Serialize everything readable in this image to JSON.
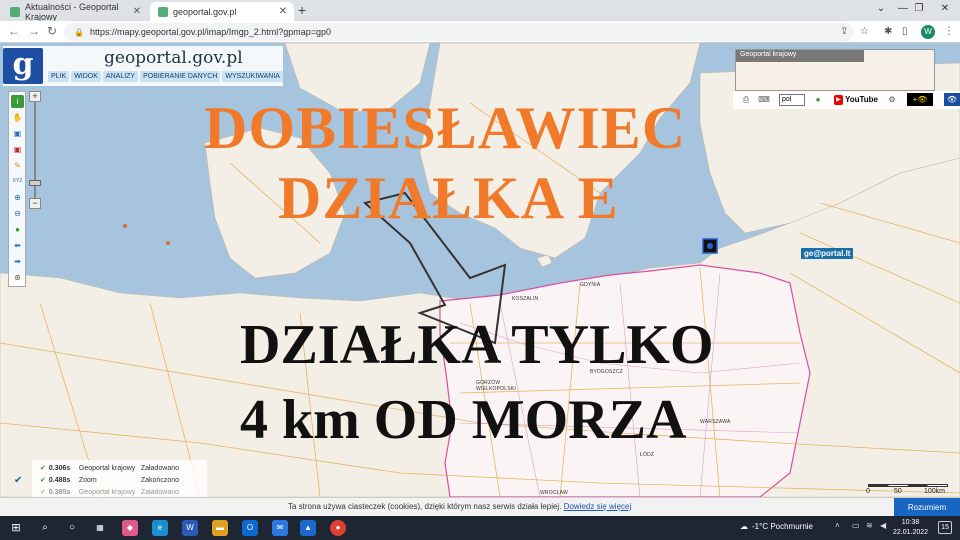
{
  "browser": {
    "tabs": [
      {
        "label": "Aktualności - Geoportal Krajowy"
      },
      {
        "label": "geoportal.gov.pl"
      }
    ],
    "url": "https://mapy.geoportal.gov.pl/imap/Imgp_2.html?gpmap=gp0",
    "profile_initial": "W"
  },
  "geoportal": {
    "logo_letter": "g",
    "title": "geoportal.gov.pl",
    "menu": [
      "PLIK",
      "WIDOK",
      "ANALIZY",
      "POBIERANIE DANYCH",
      "WYSZUKIWANIA"
    ],
    "minimap_label": "Geoportal krajowy",
    "lang": "pol",
    "youtube": "YouTube",
    "gelt": "ge@portal.lt"
  },
  "overlay": {
    "line1": "DOBIESŁAWIEC",
    "line2": "DZIAŁKA E",
    "line3": "DZIAŁKA TYLKO",
    "line4": "4 km OD MORZA"
  },
  "cities": {
    "koszalin": "KOSZALIN",
    "gdynia": "GDYNIA",
    "gorzow": "GORZÓW WIELKOPOLSKI",
    "bydgoszcz": "BYDGOSZCZ",
    "warszawa": "WARSZAWA",
    "wroclaw": "WROCŁAW",
    "lodz": "ŁÓDŹ"
  },
  "status_log": [
    {
      "time": "0.306s",
      "source": "Geoportal krajowy",
      "state": "Załadowano"
    },
    {
      "time": "0.488s",
      "source": "Zoom",
      "state": "Zakończono"
    },
    {
      "time": "0.385s",
      "source": "Geoportal krajowy",
      "state": "Załadowano"
    }
  ],
  "scale": {
    "labels": [
      "0",
      "50",
      "100km"
    ]
  },
  "cookie": {
    "text": "Ta strona używa ciasteczek (cookies), dzięki którym nasz serwis działa lepiej.",
    "link": "Dowiedz się więcej",
    "button": "Rozumiem"
  },
  "taskbar": {
    "weather": "-1°C  Pochmurnie",
    "time": "10:38",
    "date": "22.01.2022",
    "notifications": "15"
  },
  "colors": {
    "sea": "#a7c4de",
    "land": "#f4efe6",
    "headline_orange": "#f07a2a",
    "headline_black": "#111111",
    "gp_blue": "#1f4fa3"
  }
}
